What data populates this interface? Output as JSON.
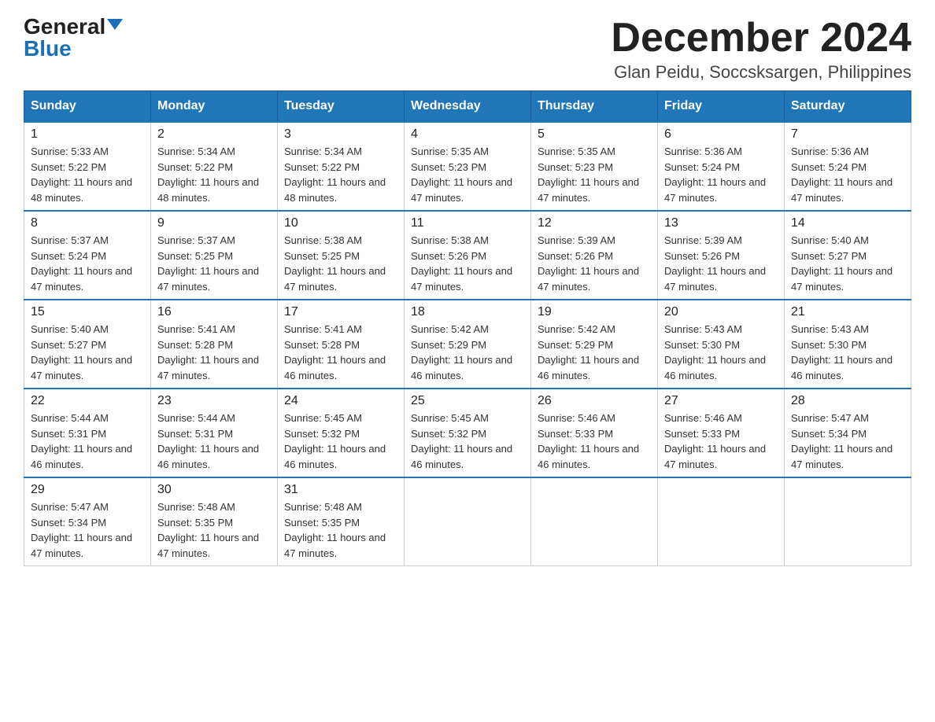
{
  "logo": {
    "general": "General",
    "blue": "Blue"
  },
  "title": {
    "month": "December 2024",
    "location": "Glan Peidu, Soccsksargen, Philippines"
  },
  "headers": [
    "Sunday",
    "Monday",
    "Tuesday",
    "Wednesday",
    "Thursday",
    "Friday",
    "Saturday"
  ],
  "weeks": [
    [
      {
        "day": "1",
        "sunrise": "5:33 AM",
        "sunset": "5:22 PM",
        "daylight": "11 hours and 48 minutes."
      },
      {
        "day": "2",
        "sunrise": "5:34 AM",
        "sunset": "5:22 PM",
        "daylight": "11 hours and 48 minutes."
      },
      {
        "day": "3",
        "sunrise": "5:34 AM",
        "sunset": "5:22 PM",
        "daylight": "11 hours and 48 minutes."
      },
      {
        "day": "4",
        "sunrise": "5:35 AM",
        "sunset": "5:23 PM",
        "daylight": "11 hours and 47 minutes."
      },
      {
        "day": "5",
        "sunrise": "5:35 AM",
        "sunset": "5:23 PM",
        "daylight": "11 hours and 47 minutes."
      },
      {
        "day": "6",
        "sunrise": "5:36 AM",
        "sunset": "5:24 PM",
        "daylight": "11 hours and 47 minutes."
      },
      {
        "day": "7",
        "sunrise": "5:36 AM",
        "sunset": "5:24 PM",
        "daylight": "11 hours and 47 minutes."
      }
    ],
    [
      {
        "day": "8",
        "sunrise": "5:37 AM",
        "sunset": "5:24 PM",
        "daylight": "11 hours and 47 minutes."
      },
      {
        "day": "9",
        "sunrise": "5:37 AM",
        "sunset": "5:25 PM",
        "daylight": "11 hours and 47 minutes."
      },
      {
        "day": "10",
        "sunrise": "5:38 AM",
        "sunset": "5:25 PM",
        "daylight": "11 hours and 47 minutes."
      },
      {
        "day": "11",
        "sunrise": "5:38 AM",
        "sunset": "5:26 PM",
        "daylight": "11 hours and 47 minutes."
      },
      {
        "day": "12",
        "sunrise": "5:39 AM",
        "sunset": "5:26 PM",
        "daylight": "11 hours and 47 minutes."
      },
      {
        "day": "13",
        "sunrise": "5:39 AM",
        "sunset": "5:26 PM",
        "daylight": "11 hours and 47 minutes."
      },
      {
        "day": "14",
        "sunrise": "5:40 AM",
        "sunset": "5:27 PM",
        "daylight": "11 hours and 47 minutes."
      }
    ],
    [
      {
        "day": "15",
        "sunrise": "5:40 AM",
        "sunset": "5:27 PM",
        "daylight": "11 hours and 47 minutes."
      },
      {
        "day": "16",
        "sunrise": "5:41 AM",
        "sunset": "5:28 PM",
        "daylight": "11 hours and 47 minutes."
      },
      {
        "day": "17",
        "sunrise": "5:41 AM",
        "sunset": "5:28 PM",
        "daylight": "11 hours and 46 minutes."
      },
      {
        "day": "18",
        "sunrise": "5:42 AM",
        "sunset": "5:29 PM",
        "daylight": "11 hours and 46 minutes."
      },
      {
        "day": "19",
        "sunrise": "5:42 AM",
        "sunset": "5:29 PM",
        "daylight": "11 hours and 46 minutes."
      },
      {
        "day": "20",
        "sunrise": "5:43 AM",
        "sunset": "5:30 PM",
        "daylight": "11 hours and 46 minutes."
      },
      {
        "day": "21",
        "sunrise": "5:43 AM",
        "sunset": "5:30 PM",
        "daylight": "11 hours and 46 minutes."
      }
    ],
    [
      {
        "day": "22",
        "sunrise": "5:44 AM",
        "sunset": "5:31 PM",
        "daylight": "11 hours and 46 minutes."
      },
      {
        "day": "23",
        "sunrise": "5:44 AM",
        "sunset": "5:31 PM",
        "daylight": "11 hours and 46 minutes."
      },
      {
        "day": "24",
        "sunrise": "5:45 AM",
        "sunset": "5:32 PM",
        "daylight": "11 hours and 46 minutes."
      },
      {
        "day": "25",
        "sunrise": "5:45 AM",
        "sunset": "5:32 PM",
        "daylight": "11 hours and 46 minutes."
      },
      {
        "day": "26",
        "sunrise": "5:46 AM",
        "sunset": "5:33 PM",
        "daylight": "11 hours and 46 minutes."
      },
      {
        "day": "27",
        "sunrise": "5:46 AM",
        "sunset": "5:33 PM",
        "daylight": "11 hours and 47 minutes."
      },
      {
        "day": "28",
        "sunrise": "5:47 AM",
        "sunset": "5:34 PM",
        "daylight": "11 hours and 47 minutes."
      }
    ],
    [
      {
        "day": "29",
        "sunrise": "5:47 AM",
        "sunset": "5:34 PM",
        "daylight": "11 hours and 47 minutes."
      },
      {
        "day": "30",
        "sunrise": "5:48 AM",
        "sunset": "5:35 PM",
        "daylight": "11 hours and 47 minutes."
      },
      {
        "day": "31",
        "sunrise": "5:48 AM",
        "sunset": "5:35 PM",
        "daylight": "11 hours and 47 minutes."
      },
      null,
      null,
      null,
      null
    ]
  ]
}
